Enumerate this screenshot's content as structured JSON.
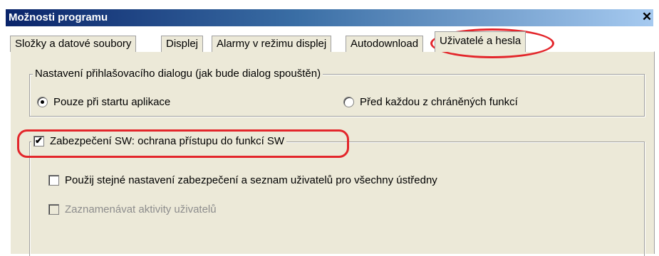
{
  "window": {
    "title": "Možnosti programu",
    "close_label": "✕"
  },
  "tabs": [
    {
      "label": "Složky a datové soubory"
    },
    {
      "label": "Displej"
    },
    {
      "label": "Alarmy v režimu displej"
    },
    {
      "label": "Autodownload"
    },
    {
      "label": "Uživatelé a hesla"
    }
  ],
  "login_group": {
    "legend": "Nastavení přihlašovacího dialogu (jak bude dialog spouštěn)",
    "options": [
      {
        "label": "Pouze při startu aplikace",
        "selected": true
      },
      {
        "label": "Před každou z chráněných funkcí",
        "selected": false
      }
    ]
  },
  "security_group": {
    "legend": "Zabezpečení SW: ochrana přístupu do funkcí SW",
    "checked": true,
    "options": [
      {
        "label": "Použij stejné nastavení zabezpečení a seznam uživatelů pro všechny ústředny",
        "checked": false,
        "enabled": true
      },
      {
        "label": "Zaznamenávat aktivity uživatelů",
        "checked": false,
        "enabled": false
      }
    ]
  },
  "annotation_color": "#e3262b"
}
